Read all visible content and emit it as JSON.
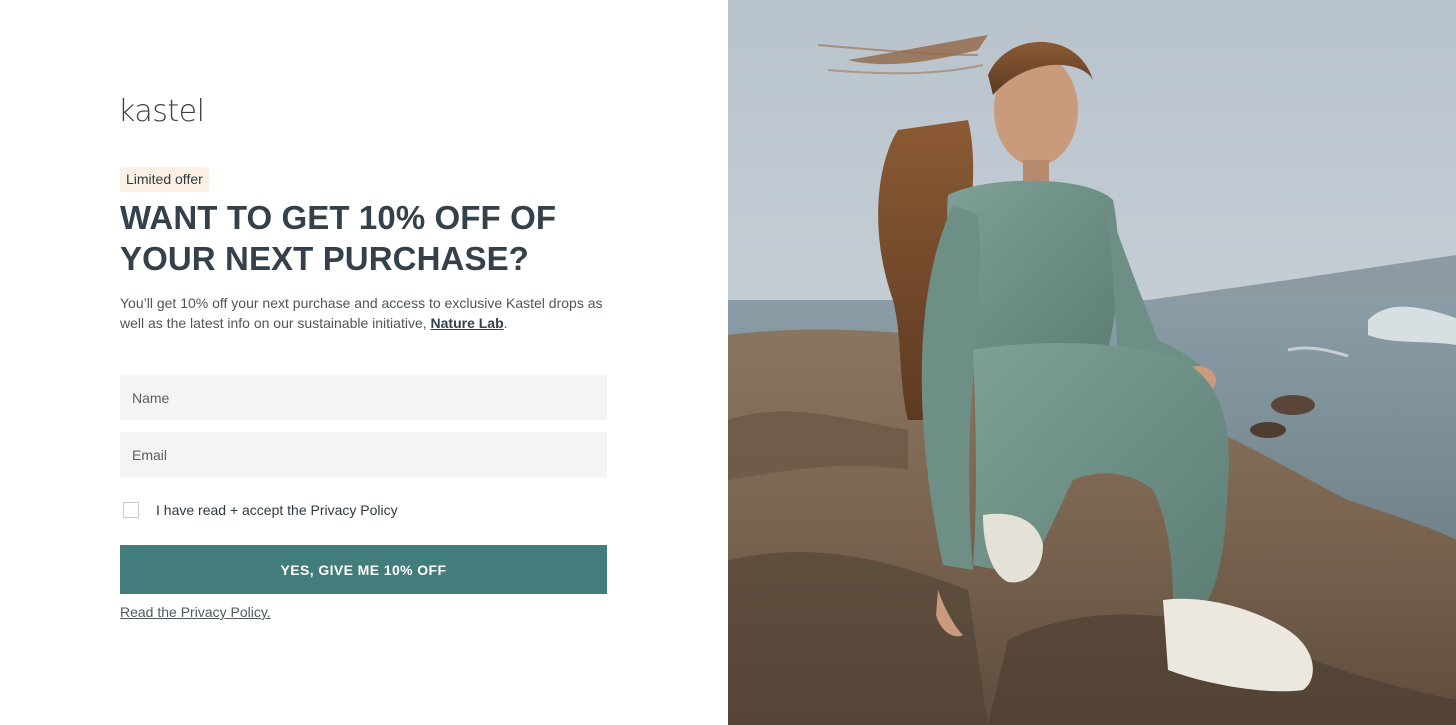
{
  "brand": {
    "logo_text": "kastel"
  },
  "offer": {
    "badge": "Limited offer",
    "headline": "WANT TO GET 10% OFF OF YOUR NEXT PURCHASE?",
    "description_prefix": "You’ll get 10% off your next purchase and access to exclusive Kastel drops as well as the latest info on our sustainable initiative, ",
    "description_link": "Nature Lab",
    "description_suffix": "."
  },
  "form": {
    "name_placeholder": "Name",
    "email_placeholder": "Email",
    "consent_label": "I have read + accept the Privacy Policy",
    "consent_checked": false,
    "submit_label": "YES, GIVE ME 10% OFF",
    "privacy_link": "Read the Privacy Policy."
  },
  "colors": {
    "accent": "#427d7c",
    "badge_bg": "#faf0e3",
    "field_bg": "#f4f4f2",
    "heading": "#34414a"
  },
  "hero_image": {
    "icon": "hero-photo"
  }
}
